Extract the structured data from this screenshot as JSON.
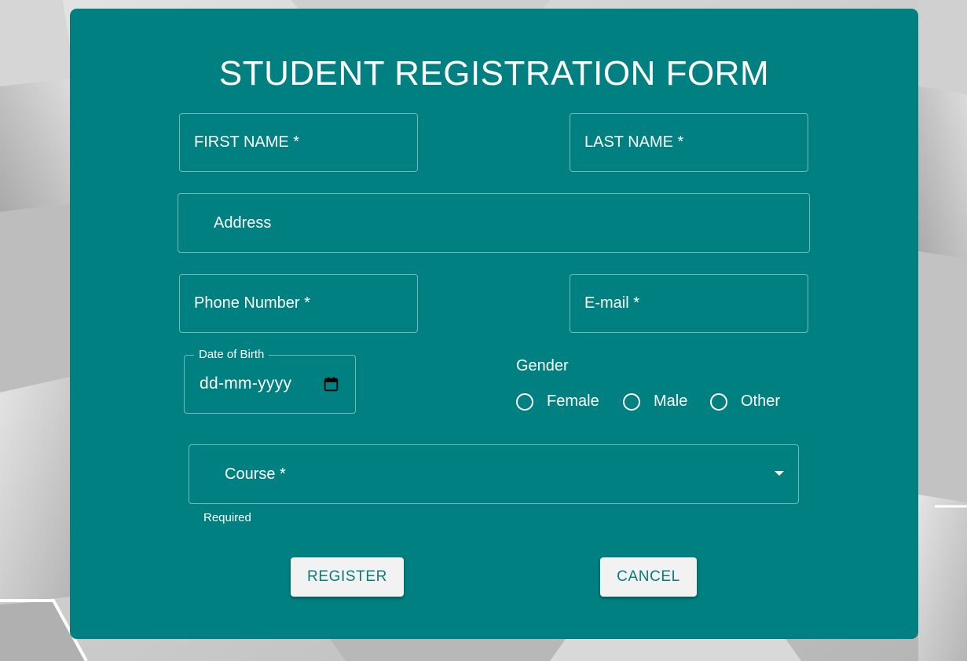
{
  "form": {
    "title": "STUDENT REGISTRATION FORM",
    "fields": {
      "first_name": {
        "label": "FIRST NAME *"
      },
      "last_name": {
        "label": "LAST NAME *"
      },
      "address": {
        "label": "Address"
      },
      "phone": {
        "label": "Phone Number *"
      },
      "email": {
        "label": "E-mail *"
      },
      "dob": {
        "label": "Date of Birth",
        "value": "dd-mm-yyyy"
      },
      "course": {
        "label": "Course *",
        "helper": "Required"
      }
    },
    "gender": {
      "label": "Gender",
      "options": [
        "Female",
        "Male",
        "Other"
      ]
    },
    "buttons": {
      "register": "REGISTER",
      "cancel": "CANCEL"
    }
  },
  "colors": {
    "card": "#008080",
    "text": "#ffffff",
    "button_bg": "#f2f2f2",
    "button_text": "#0a7a7a",
    "background": "#c9c9c9"
  },
  "icons": {
    "date_picker": "calendar-icon",
    "course_select": "caret-down-icon"
  }
}
